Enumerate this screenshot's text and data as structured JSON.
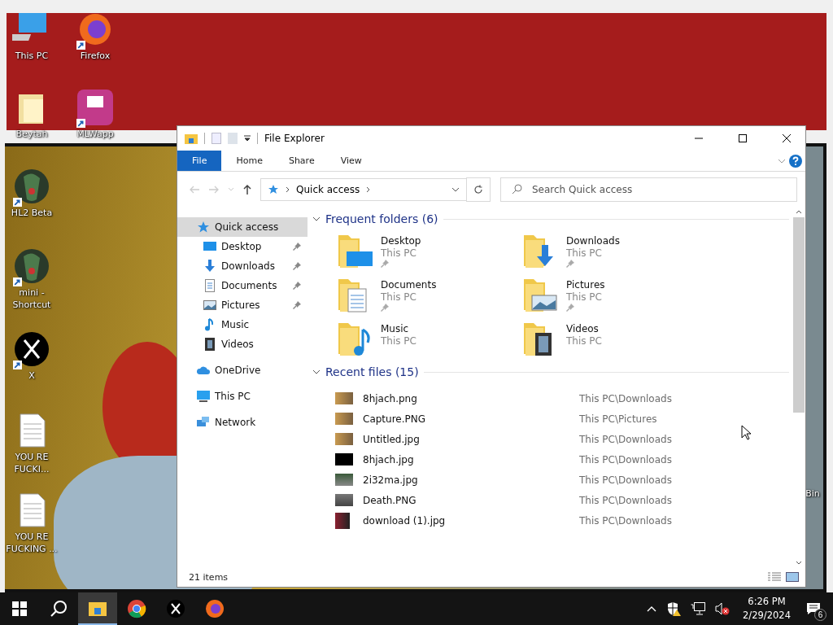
{
  "desktop_icons": [
    {
      "label": "This PC",
      "kind": "pc",
      "shortcut": false
    },
    {
      "label": "Firefox",
      "kind": "firefox",
      "shortcut": true
    },
    {
      "label": "Beytah",
      "kind": "folder",
      "shortcut": false
    },
    {
      "label": "MLWapp",
      "kind": "app",
      "shortcut": true
    },
    {
      "label": "HL2 Beta",
      "kind": "game",
      "shortcut": true
    },
    {
      "label": "mini - Shortcut",
      "kind": "game",
      "shortcut": true
    },
    {
      "label": "X",
      "kind": "x",
      "shortcut": true
    },
    {
      "label": "YOU RE FUCKI...",
      "kind": "document",
      "shortcut": false
    },
    {
      "label": "YOU RE FUCKING ...",
      "kind": "document",
      "shortcut": false
    },
    {
      "label": "Bin",
      "kind": "partial",
      "shortcut": false
    }
  ],
  "window": {
    "title": "File Explorer",
    "ribbon_tabs": [
      {
        "label": "File",
        "kind": "menu"
      },
      {
        "label": "Home",
        "kind": "tab"
      },
      {
        "label": "Share",
        "kind": "tab"
      },
      {
        "label": "View",
        "kind": "tab"
      }
    ],
    "address": {
      "path": "Quick access"
    },
    "search": {
      "placeholder": "Search Quick access"
    },
    "sidebar": [
      {
        "label": "Quick access",
        "kind": "star",
        "selected": true,
        "children": [
          {
            "label": "Desktop",
            "kind": "desktop",
            "pinned": true,
            "selected": false
          },
          {
            "label": "Downloads",
            "kind": "downloads",
            "pinned": true,
            "selected": false
          },
          {
            "label": "Documents",
            "kind": "documents",
            "pinned": true,
            "selected": false
          },
          {
            "label": "Pictures",
            "kind": "pictures",
            "pinned": true,
            "selected": false
          },
          {
            "label": "Music",
            "kind": "music",
            "pinned": false,
            "selected": false
          },
          {
            "label": "Videos",
            "kind": "videos",
            "pinned": false,
            "selected": false
          }
        ]
      },
      {
        "label": "OneDrive",
        "kind": "cloud",
        "selected": false
      },
      {
        "label": "This PC",
        "kind": "pc",
        "selected": false
      },
      {
        "label": "Network",
        "kind": "network",
        "selected": false
      }
    ],
    "frequent_folders": {
      "heading": "Frequent folders (6)",
      "expanded": true,
      "items": [
        {
          "name": "Desktop",
          "location": "This PC",
          "kind": "desktop",
          "pinned": true
        },
        {
          "name": "Downloads",
          "location": "This PC",
          "kind": "downloads",
          "pinned": true
        },
        {
          "name": "Documents",
          "location": "This PC",
          "kind": "documents",
          "pinned": true
        },
        {
          "name": "Pictures",
          "location": "This PC",
          "kind": "pictures",
          "pinned": true
        },
        {
          "name": "Music",
          "location": "This PC",
          "kind": "music",
          "pinned": false
        },
        {
          "name": "Videos",
          "location": "This PC",
          "kind": "videos",
          "pinned": false
        }
      ]
    },
    "recent_files": {
      "heading": "Recent files (15)",
      "expanded": true,
      "items": [
        {
          "name": "8hjach.png",
          "location": "This PC\\Downloads"
        },
        {
          "name": "Capture.PNG",
          "location": "This PC\\Pictures"
        },
        {
          "name": "Untitled.jpg",
          "location": "This PC\\Downloads"
        },
        {
          "name": "8hjach.jpg",
          "location": "This PC\\Downloads"
        },
        {
          "name": "2i32ma.jpg",
          "location": "This PC\\Downloads"
        },
        {
          "name": "Death.PNG",
          "location": "This PC\\Downloads"
        },
        {
          "name": "download (1).jpg",
          "location": "This PC\\Downloads"
        }
      ]
    },
    "status_bar": {
      "item_count": "21 items"
    }
  },
  "taskbar": {
    "apps": [
      {
        "kind": "explorer",
        "active": true
      },
      {
        "kind": "chrome",
        "active": false
      },
      {
        "kind": "x",
        "active": false
      },
      {
        "kind": "firefox",
        "active": false
      }
    ],
    "time": "6:26 PM",
    "date": "2/29/2024",
    "notification_count": "6"
  }
}
